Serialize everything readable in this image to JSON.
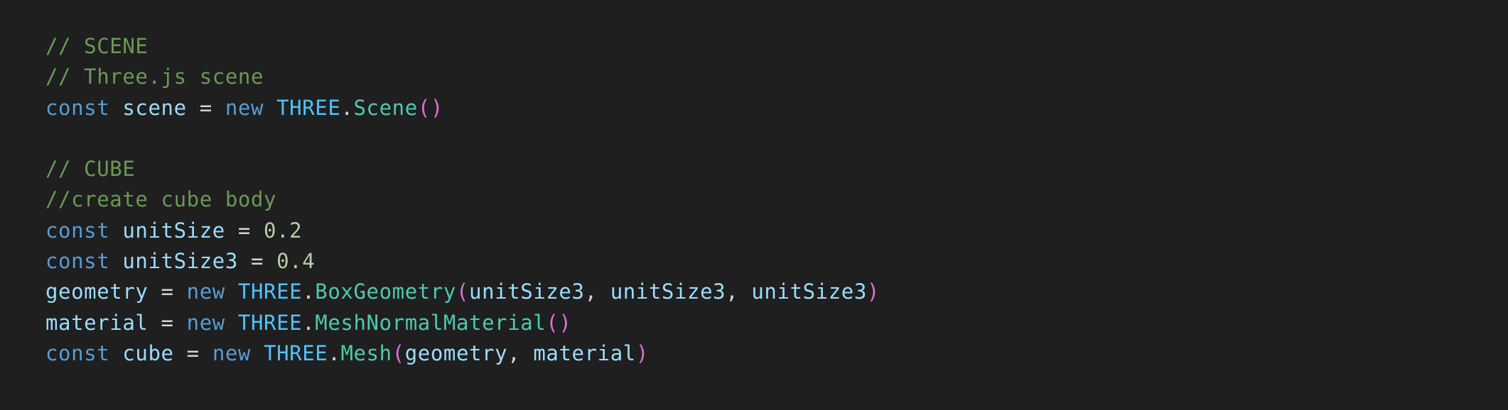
{
  "colors": {
    "background": "#1f1f1f",
    "comment": "#6a9955",
    "keyword": "#569cd6",
    "variable": "#9cdcfe",
    "constant": "#4fc1ff",
    "class": "#4ec9b0",
    "number": "#b5cea8",
    "paren": "#da70d6",
    "text": "#d4d4d4"
  },
  "code": {
    "lines": [
      [
        {
          "t": "comment",
          "v": "// SCENE"
        }
      ],
      [
        {
          "t": "comment",
          "v": "// Three.js scene"
        }
      ],
      [
        {
          "t": "keyword",
          "v": "const"
        },
        {
          "t": "plain",
          "v": " "
        },
        {
          "t": "variable",
          "v": "scene"
        },
        {
          "t": "plain",
          "v": " = "
        },
        {
          "t": "keyword",
          "v": "new"
        },
        {
          "t": "plain",
          "v": " "
        },
        {
          "t": "constant",
          "v": "THREE"
        },
        {
          "t": "punct",
          "v": "."
        },
        {
          "t": "class",
          "v": "Scene"
        },
        {
          "t": "paren",
          "v": "()"
        }
      ],
      [],
      [
        {
          "t": "comment",
          "v": "// CUBE"
        }
      ],
      [
        {
          "t": "comment",
          "v": "//create cube body"
        }
      ],
      [
        {
          "t": "keyword",
          "v": "const"
        },
        {
          "t": "plain",
          "v": " "
        },
        {
          "t": "variable",
          "v": "unitSize"
        },
        {
          "t": "plain",
          "v": " = "
        },
        {
          "t": "number",
          "v": "0.2"
        }
      ],
      [
        {
          "t": "keyword",
          "v": "const"
        },
        {
          "t": "plain",
          "v": " "
        },
        {
          "t": "variable",
          "v": "unitSize3"
        },
        {
          "t": "plain",
          "v": " = "
        },
        {
          "t": "number",
          "v": "0.4"
        }
      ],
      [
        {
          "t": "variable",
          "v": "geometry"
        },
        {
          "t": "plain",
          "v": " = "
        },
        {
          "t": "keyword",
          "v": "new"
        },
        {
          "t": "plain",
          "v": " "
        },
        {
          "t": "constant",
          "v": "THREE"
        },
        {
          "t": "punct",
          "v": "."
        },
        {
          "t": "class",
          "v": "BoxGeometry"
        },
        {
          "t": "paren",
          "v": "("
        },
        {
          "t": "variable",
          "v": "unitSize3"
        },
        {
          "t": "plain",
          "v": ", "
        },
        {
          "t": "variable",
          "v": "unitSize3"
        },
        {
          "t": "plain",
          "v": ", "
        },
        {
          "t": "variable",
          "v": "unitSize3"
        },
        {
          "t": "paren",
          "v": ")"
        }
      ],
      [
        {
          "t": "variable",
          "v": "material"
        },
        {
          "t": "plain",
          "v": " = "
        },
        {
          "t": "keyword",
          "v": "new"
        },
        {
          "t": "plain",
          "v": " "
        },
        {
          "t": "constant",
          "v": "THREE"
        },
        {
          "t": "punct",
          "v": "."
        },
        {
          "t": "class",
          "v": "MeshNormalMaterial"
        },
        {
          "t": "paren",
          "v": "()"
        }
      ],
      [
        {
          "t": "keyword",
          "v": "const"
        },
        {
          "t": "plain",
          "v": " "
        },
        {
          "t": "variable",
          "v": "cube"
        },
        {
          "t": "plain",
          "v": " = "
        },
        {
          "t": "keyword",
          "v": "new"
        },
        {
          "t": "plain",
          "v": " "
        },
        {
          "t": "constant",
          "v": "THREE"
        },
        {
          "t": "punct",
          "v": "."
        },
        {
          "t": "class",
          "v": "Mesh"
        },
        {
          "t": "paren",
          "v": "("
        },
        {
          "t": "variable",
          "v": "geometry"
        },
        {
          "t": "plain",
          "v": ", "
        },
        {
          "t": "variable",
          "v": "material"
        },
        {
          "t": "paren",
          "v": ")"
        }
      ]
    ]
  }
}
